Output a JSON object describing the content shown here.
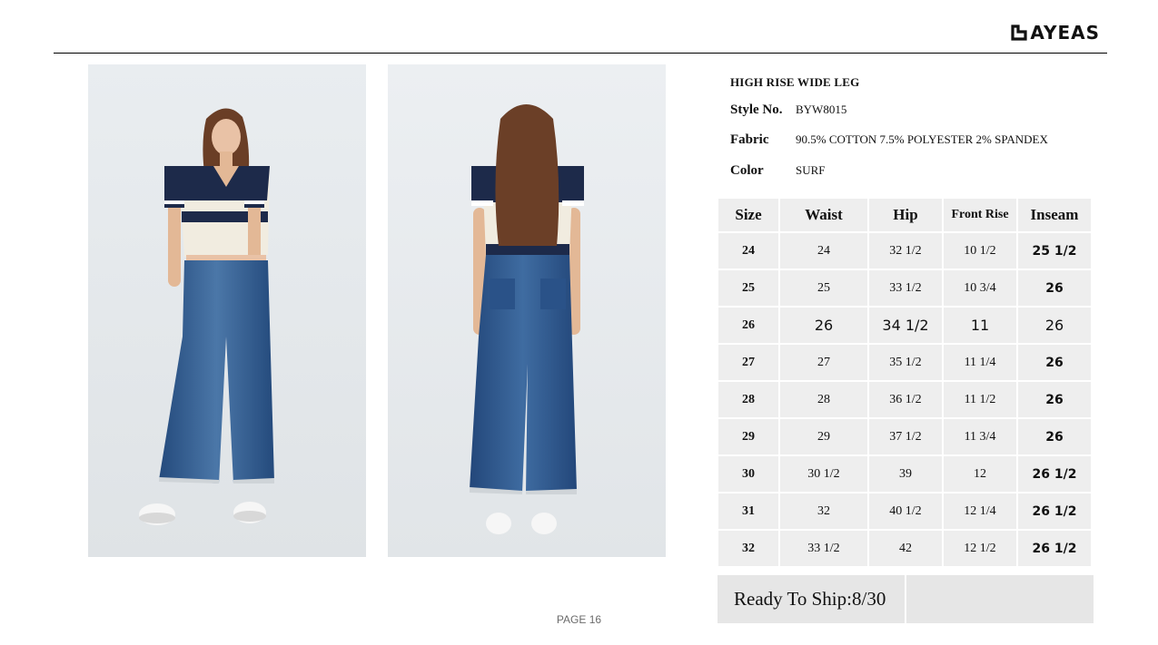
{
  "brand": {
    "logo_text": "AYEAS"
  },
  "product": {
    "title": "HIGH RISE WIDE LEG",
    "style_label": "Style No.",
    "style_value": "BYW8015",
    "fabric_label": "Fabric",
    "fabric_value": "90.5% COTTON 7.5% POLYESTER 2% SPANDEX",
    "color_label": "Color",
    "color_value": "SURF"
  },
  "size_table": {
    "headers": [
      "Size",
      "Waist",
      "Hip",
      "Front Rise",
      "Inseam"
    ],
    "rows": [
      [
        "24",
        "24",
        "32  1/2",
        "10  1/2",
        "25  1/2"
      ],
      [
        "25",
        "25",
        "33  1/2",
        "10  3/4",
        "26"
      ],
      [
        "26",
        "26",
        "34 1/2",
        "11",
        "26"
      ],
      [
        "27",
        "27",
        "35  1/2",
        "11  1/4",
        "26"
      ],
      [
        "28",
        "28",
        "36  1/2",
        "11  1/2",
        "26"
      ],
      [
        "29",
        "29",
        "37  1/2",
        "11  3/4",
        "26"
      ],
      [
        "30",
        "30  1/2",
        "39",
        "12",
        "26  1/2"
      ],
      [
        "31",
        "32",
        "40  1/2",
        "12  1/4",
        "26  1/2"
      ],
      [
        "32",
        "33  1/2",
        "42",
        "12  1/2",
        "26  1/2"
      ]
    ]
  },
  "ship": {
    "label": "Ready To Ship:8/30"
  },
  "footer": {
    "page": "PAGE 16"
  },
  "colors": {
    "denim": "#2f5a92",
    "navy": "#1d2a4a",
    "cream": "#f1ece0",
    "panel": "#eeeeee"
  }
}
